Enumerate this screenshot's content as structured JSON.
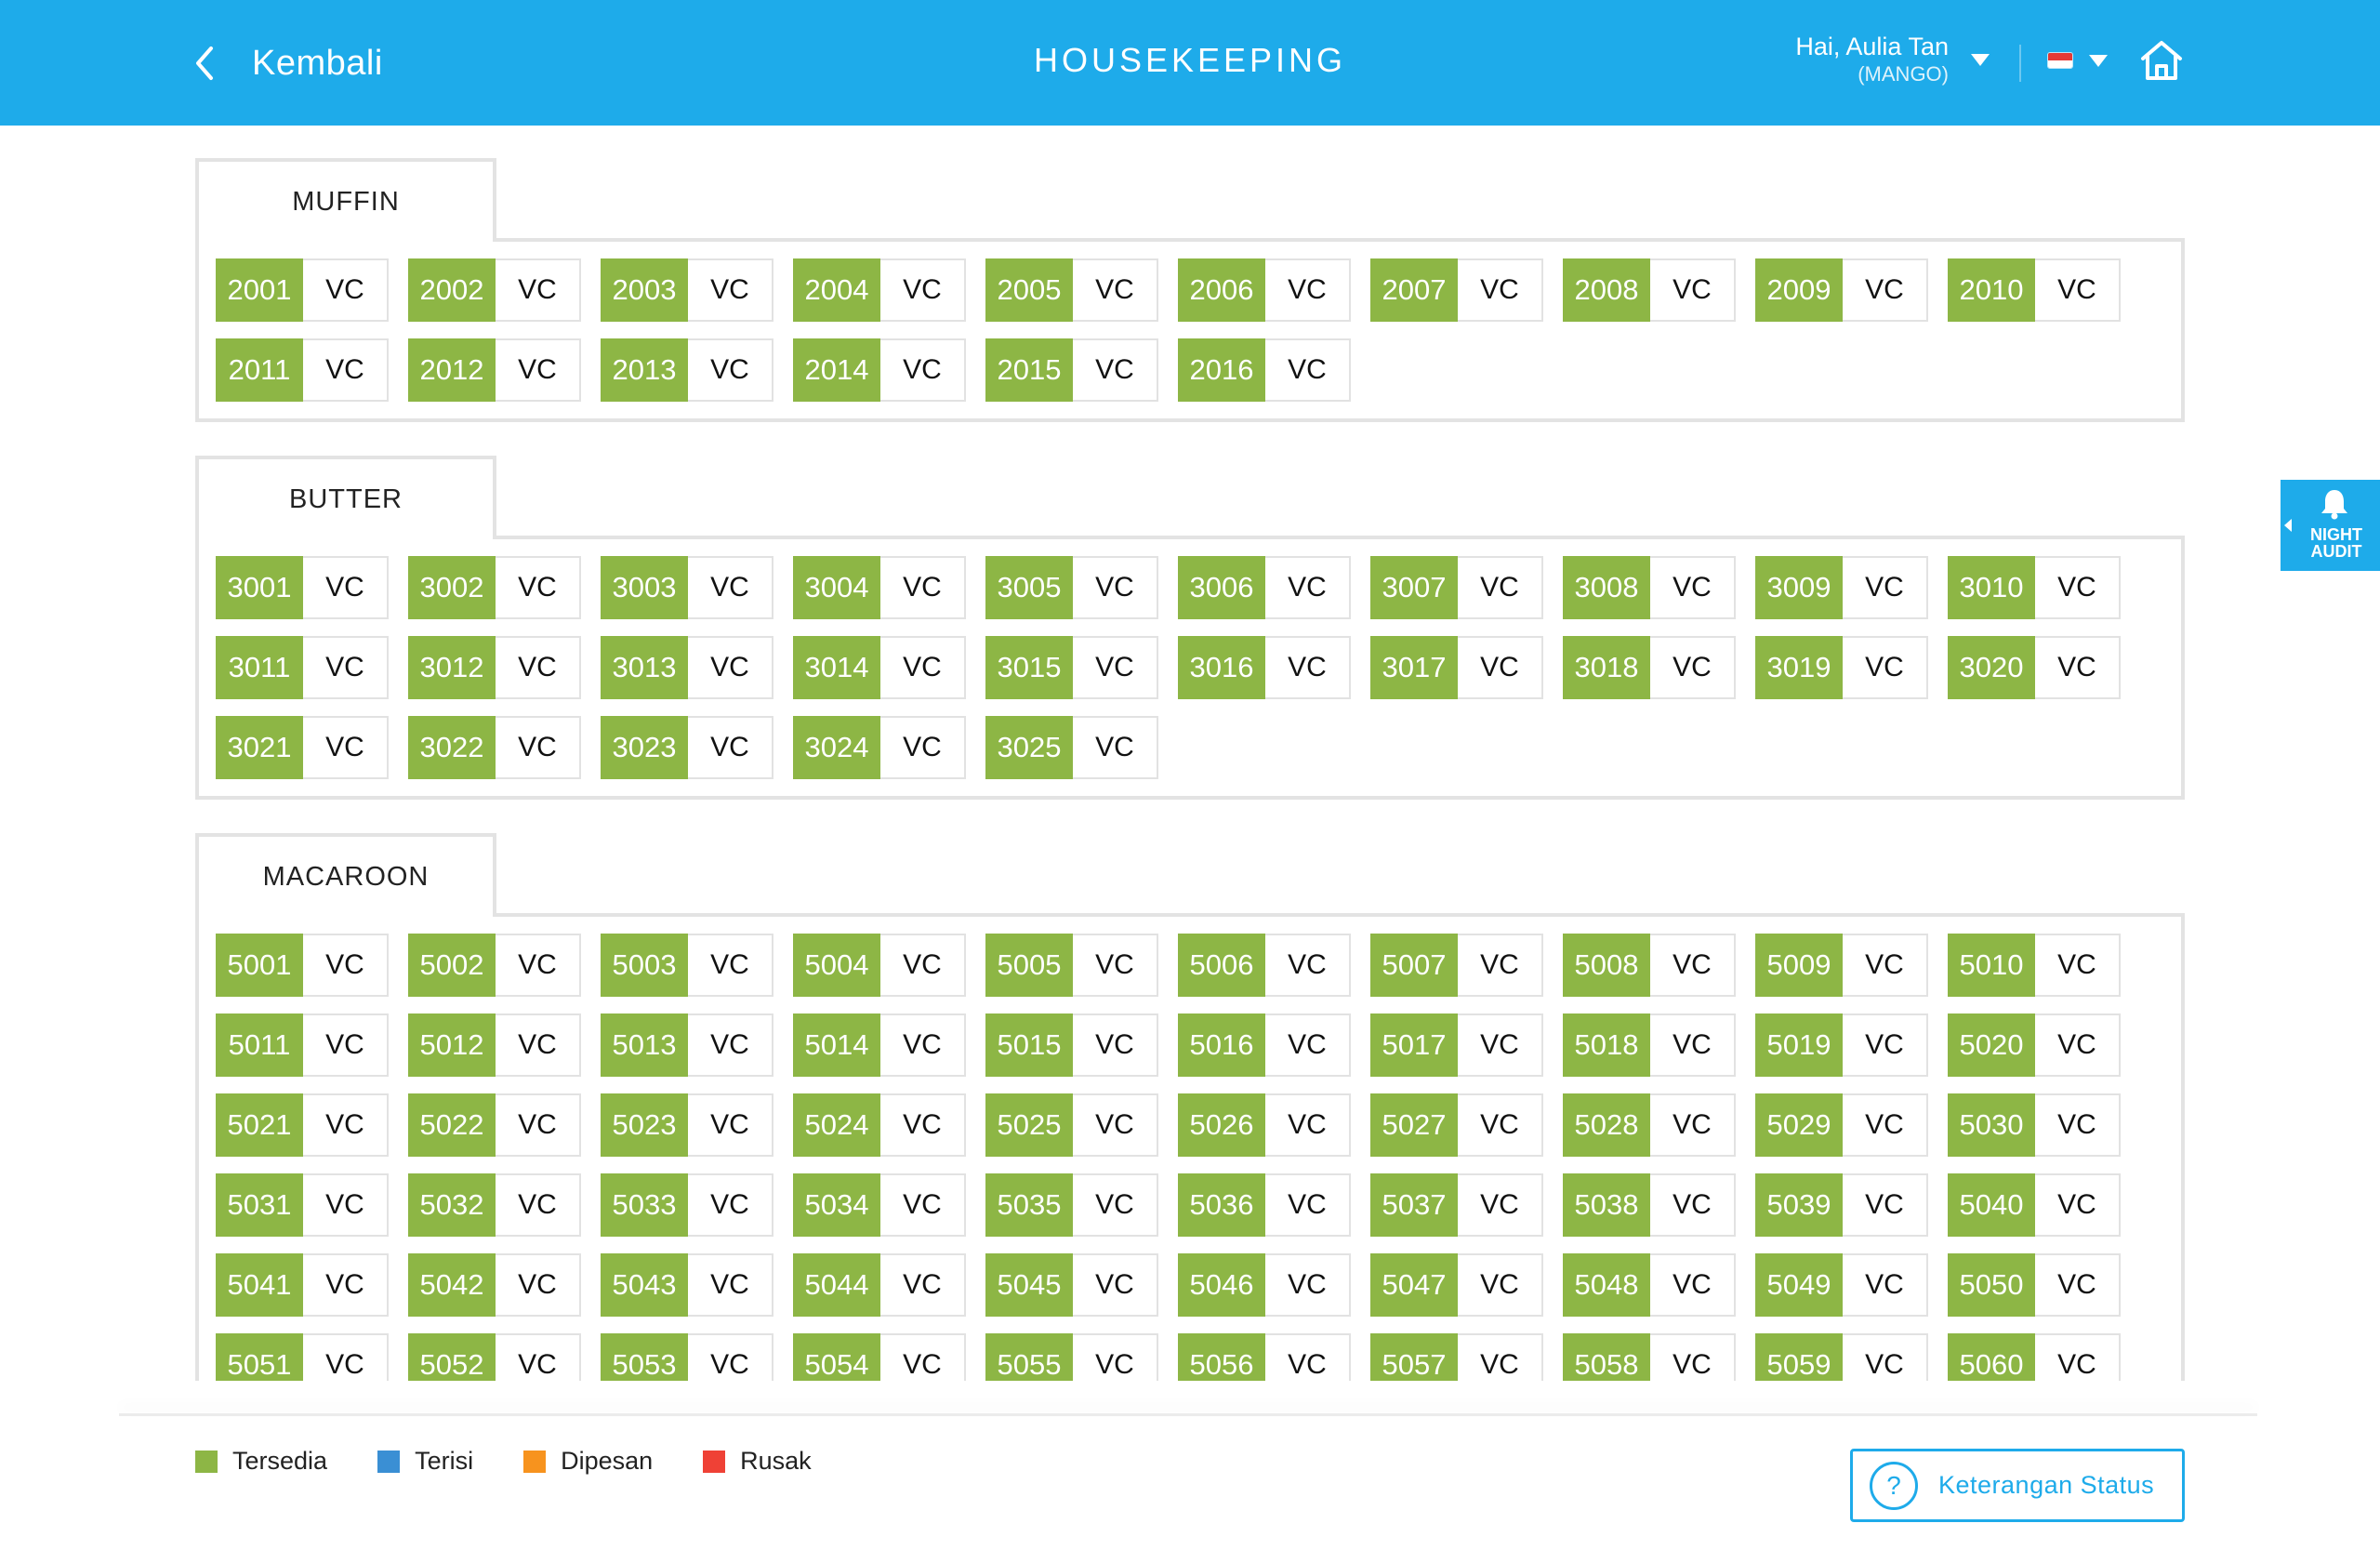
{
  "header": {
    "back_label": "Kembali",
    "title": "HOUSEKEEPING",
    "user_greeting": "Hai, Aulia Tan",
    "user_org": "(MANGO)"
  },
  "night_audit": {
    "line1": "NIGHT",
    "line2": "AUDIT"
  },
  "sections": [
    {
      "name": "MUFFIN",
      "rooms": [
        {
          "number": "2001",
          "status": "VC"
        },
        {
          "number": "2002",
          "status": "VC"
        },
        {
          "number": "2003",
          "status": "VC"
        },
        {
          "number": "2004",
          "status": "VC"
        },
        {
          "number": "2005",
          "status": "VC"
        },
        {
          "number": "2006",
          "status": "VC"
        },
        {
          "number": "2007",
          "status": "VC"
        },
        {
          "number": "2008",
          "status": "VC"
        },
        {
          "number": "2009",
          "status": "VC"
        },
        {
          "number": "2010",
          "status": "VC"
        },
        {
          "number": "2011",
          "status": "VC"
        },
        {
          "number": "2012",
          "status": "VC"
        },
        {
          "number": "2013",
          "status": "VC"
        },
        {
          "number": "2014",
          "status": "VC"
        },
        {
          "number": "2015",
          "status": "VC"
        },
        {
          "number": "2016",
          "status": "VC"
        }
      ]
    },
    {
      "name": "BUTTER",
      "rooms": [
        {
          "number": "3001",
          "status": "VC"
        },
        {
          "number": "3002",
          "status": "VC"
        },
        {
          "number": "3003",
          "status": "VC"
        },
        {
          "number": "3004",
          "status": "VC"
        },
        {
          "number": "3005",
          "status": "VC"
        },
        {
          "number": "3006",
          "status": "VC"
        },
        {
          "number": "3007",
          "status": "VC"
        },
        {
          "number": "3008",
          "status": "VC"
        },
        {
          "number": "3009",
          "status": "VC"
        },
        {
          "number": "3010",
          "status": "VC"
        },
        {
          "number": "3011",
          "status": "VC"
        },
        {
          "number": "3012",
          "status": "VC"
        },
        {
          "number": "3013",
          "status": "VC"
        },
        {
          "number": "3014",
          "status": "VC"
        },
        {
          "number": "3015",
          "status": "VC"
        },
        {
          "number": "3016",
          "status": "VC"
        },
        {
          "number": "3017",
          "status": "VC"
        },
        {
          "number": "3018",
          "status": "VC"
        },
        {
          "number": "3019",
          "status": "VC"
        },
        {
          "number": "3020",
          "status": "VC"
        },
        {
          "number": "3021",
          "status": "VC"
        },
        {
          "number": "3022",
          "status": "VC"
        },
        {
          "number": "3023",
          "status": "VC"
        },
        {
          "number": "3024",
          "status": "VC"
        },
        {
          "number": "3025",
          "status": "VC"
        }
      ]
    },
    {
      "name": "MACAROON",
      "rooms": [
        {
          "number": "5001",
          "status": "VC"
        },
        {
          "number": "5002",
          "status": "VC"
        },
        {
          "number": "5003",
          "status": "VC"
        },
        {
          "number": "5004",
          "status": "VC"
        },
        {
          "number": "5005",
          "status": "VC"
        },
        {
          "number": "5006",
          "status": "VC"
        },
        {
          "number": "5007",
          "status": "VC"
        },
        {
          "number": "5008",
          "status": "VC"
        },
        {
          "number": "5009",
          "status": "VC"
        },
        {
          "number": "5010",
          "status": "VC"
        },
        {
          "number": "5011",
          "status": "VC"
        },
        {
          "number": "5012",
          "status": "VC"
        },
        {
          "number": "5013",
          "status": "VC"
        },
        {
          "number": "5014",
          "status": "VC"
        },
        {
          "number": "5015",
          "status": "VC"
        },
        {
          "number": "5016",
          "status": "VC"
        },
        {
          "number": "5017",
          "status": "VC"
        },
        {
          "number": "5018",
          "status": "VC"
        },
        {
          "number": "5019",
          "status": "VC"
        },
        {
          "number": "5020",
          "status": "VC"
        },
        {
          "number": "5021",
          "status": "VC"
        },
        {
          "number": "5022",
          "status": "VC"
        },
        {
          "number": "5023",
          "status": "VC"
        },
        {
          "number": "5024",
          "status": "VC"
        },
        {
          "number": "5025",
          "status": "VC"
        },
        {
          "number": "5026",
          "status": "VC"
        },
        {
          "number": "5027",
          "status": "VC"
        },
        {
          "number": "5028",
          "status": "VC"
        },
        {
          "number": "5029",
          "status": "VC"
        },
        {
          "number": "5030",
          "status": "VC"
        },
        {
          "number": "5031",
          "status": "VC"
        },
        {
          "number": "5032",
          "status": "VC"
        },
        {
          "number": "5033",
          "status": "VC"
        },
        {
          "number": "5034",
          "status": "VC"
        },
        {
          "number": "5035",
          "status": "VC"
        },
        {
          "number": "5036",
          "status": "VC"
        },
        {
          "number": "5037",
          "status": "VC"
        },
        {
          "number": "5038",
          "status": "VC"
        },
        {
          "number": "5039",
          "status": "VC"
        },
        {
          "number": "5040",
          "status": "VC"
        },
        {
          "number": "5041",
          "status": "VC"
        },
        {
          "number": "5042",
          "status": "VC"
        },
        {
          "number": "5043",
          "status": "VC"
        },
        {
          "number": "5044",
          "status": "VC"
        },
        {
          "number": "5045",
          "status": "VC"
        },
        {
          "number": "5046",
          "status": "VC"
        },
        {
          "number": "5047",
          "status": "VC"
        },
        {
          "number": "5048",
          "status": "VC"
        },
        {
          "number": "5049",
          "status": "VC"
        },
        {
          "number": "5050",
          "status": "VC"
        },
        {
          "number": "5051",
          "status": "VC"
        },
        {
          "number": "5052",
          "status": "VC"
        },
        {
          "number": "5053",
          "status": "VC"
        },
        {
          "number": "5054",
          "status": "VC"
        },
        {
          "number": "5055",
          "status": "VC"
        },
        {
          "number": "5056",
          "status": "VC"
        },
        {
          "number": "5057",
          "status": "VC"
        },
        {
          "number": "5058",
          "status": "VC"
        },
        {
          "number": "5059",
          "status": "VC"
        },
        {
          "number": "5060",
          "status": "VC"
        }
      ]
    }
  ],
  "legend": [
    {
      "label": "Tersedia",
      "color": "#8db645"
    },
    {
      "label": "Terisi",
      "color": "#3a8fd4"
    },
    {
      "label": "Dipesan",
      "color": "#f7931e"
    },
    {
      "label": "Rusak",
      "color": "#ef4136"
    }
  ],
  "status_button": {
    "icon": "?",
    "label": "Keterangan Status"
  },
  "colors": {
    "header": "#1eabea",
    "available": "#8db645"
  }
}
